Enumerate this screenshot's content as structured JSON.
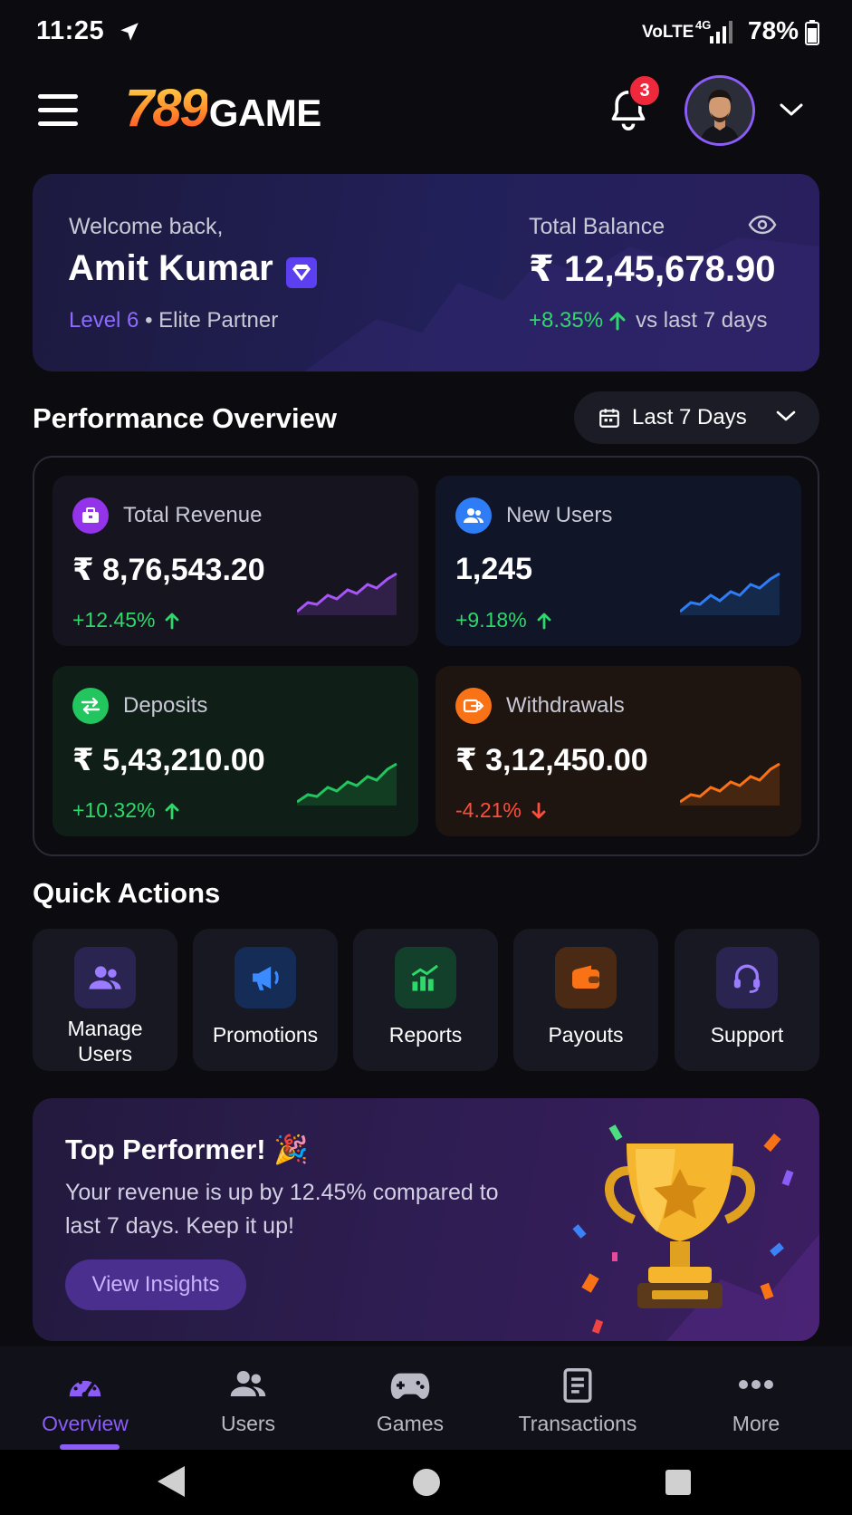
{
  "status_bar": {
    "time": "11:25",
    "volte": "VoLTE",
    "network": "4G",
    "battery": "78%"
  },
  "header": {
    "logo_number": "789",
    "logo_word": "GAME",
    "notification_count": "3"
  },
  "welcome": {
    "greeting": "Welcome back,",
    "name": "Amit Kumar",
    "level": "Level 6",
    "tier": "• Elite Partner",
    "balance_label": "Total Balance",
    "balance": "₹ 12,45,678.90",
    "balance_change": "+8.35%",
    "balance_change_suffix": "vs last 7 days"
  },
  "performance": {
    "title": "Performance Overview",
    "range": "Last 7 Days",
    "stats": [
      {
        "title": "Total Revenue",
        "value": "₹ 8,76,543.20",
        "change": "+12.45%",
        "direction": "up",
        "color": "#a855f7"
      },
      {
        "title": "New Users",
        "value": "1,245",
        "change": "+9.18%",
        "direction": "up",
        "color": "#2f7df6"
      },
      {
        "title": "Deposits",
        "value": "₹ 5,43,210.00",
        "change": "+10.32%",
        "direction": "up",
        "color": "#22c55e"
      },
      {
        "title": "Withdrawals",
        "value": "₹ 3,12,450.00",
        "change": "-4.21%",
        "direction": "down",
        "color": "#f97316"
      }
    ]
  },
  "quick_actions": {
    "title": "Quick Actions",
    "items": [
      {
        "label": "Manage Users",
        "icon": "users-icon"
      },
      {
        "label": "Promotions",
        "icon": "megaphone-icon"
      },
      {
        "label": "Reports",
        "icon": "chart-icon"
      },
      {
        "label": "Payouts",
        "icon": "wallet-icon"
      },
      {
        "label": "Support",
        "icon": "headset-icon"
      }
    ]
  },
  "promo": {
    "title": "Top Performer! 🎉",
    "description": "Your revenue is up by 12.45% compared to last 7 days. Keep it up!",
    "button": "View Insights"
  },
  "bottom_nav": {
    "items": [
      {
        "label": "Overview",
        "active": true
      },
      {
        "label": "Users",
        "active": false
      },
      {
        "label": "Games",
        "active": false
      },
      {
        "label": "Transactions",
        "active": false
      },
      {
        "label": "More",
        "active": false
      }
    ]
  },
  "colors": {
    "accent": "#8b5cf6",
    "positive": "#2fd86b",
    "negative": "#ff4d3d",
    "background": "#0b0b10"
  }
}
